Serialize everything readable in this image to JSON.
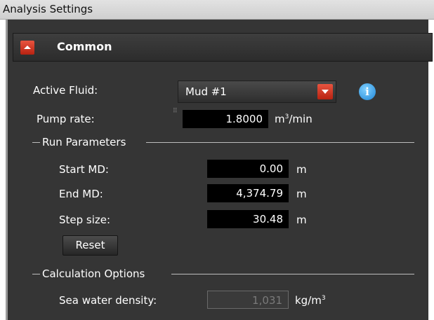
{
  "window": {
    "title": "Analysis Settings"
  },
  "section": {
    "title": "Common"
  },
  "active_fluid": {
    "label": "Active Fluid:",
    "value": "Mud #1"
  },
  "pump_rate": {
    "label": "Pump rate:",
    "value": "1.8000",
    "unit_base": "m",
    "unit_exp": "3",
    "unit_tail": "/min"
  },
  "run_parameters": {
    "group_label": "Run Parameters",
    "start_md": {
      "label": "Start MD:",
      "value": "0.00",
      "unit": "m"
    },
    "end_md": {
      "label": "End MD:",
      "value": "4,374.79",
      "unit": "m"
    },
    "step_size": {
      "label": "Step size:",
      "value": "30.48",
      "unit": "m"
    },
    "reset_label": "Reset"
  },
  "calculation_options": {
    "group_label": "Calculation Options",
    "sea_water_density": {
      "label": "Sea water density:",
      "value": "1,031",
      "unit_base": "kg/m",
      "unit_exp": "3"
    }
  },
  "icons": {
    "collapse": "collapse-up-icon",
    "dropdown": "chevron-down-icon",
    "info": "info-icon"
  },
  "colors": {
    "accent": "#d33a24",
    "panel": "#353535",
    "field": "#000000",
    "info": "#2a90dc"
  }
}
